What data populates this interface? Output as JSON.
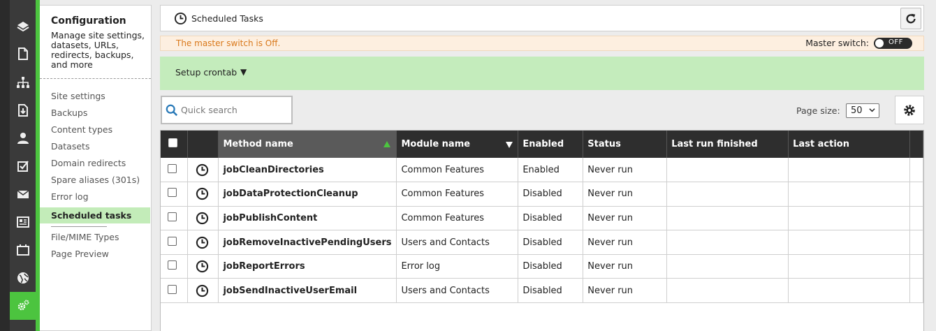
{
  "rail": {
    "icons": [
      "layers-icon",
      "document-icon",
      "sitemap-icon",
      "download-doc-icon",
      "user-icon",
      "checkbox-icon",
      "envelope-icon",
      "newspaper-icon",
      "calendar-icon",
      "globe-icon",
      "settings-icon"
    ],
    "active": "settings-icon",
    "accent": "#4cc43f"
  },
  "config": {
    "title": "Configuration",
    "description": "Manage site settings, datasets, URLs, redirects, backups, and more",
    "menu": [
      "Site settings",
      "Backups",
      "Content types",
      "Datasets",
      "Domain redirects",
      "Spare aliases (301s)",
      "Error log",
      "Scheduled tasks",
      "File/MIME Types",
      "Page Preview"
    ],
    "active": "Scheduled tasks"
  },
  "header": {
    "title": "Scheduled Tasks",
    "refresh_icon": "refresh-icon"
  },
  "warning": {
    "text": "The master switch is Off.",
    "master_label": "Master switch:",
    "toggle_state": "OFF",
    "color": "#d9781a"
  },
  "crontab": {
    "label": "Setup crontab",
    "arrow": "▼"
  },
  "search": {
    "placeholder": "Quick search"
  },
  "paging": {
    "label": "Page size:",
    "value": "50"
  },
  "table": {
    "columns": [
      "Method name",
      "Module name",
      "Enabled",
      "Status",
      "Last run finished",
      "Last action"
    ],
    "sorted_column": "Method name",
    "rows": [
      {
        "method": "jobCleanDirectories",
        "module": "Common Features",
        "enabled": "Enabled",
        "status": "Never run",
        "last_run": "",
        "last_action": ""
      },
      {
        "method": "jobDataProtectionCleanup",
        "module": "Common Features",
        "enabled": "Disabled",
        "status": "Never run",
        "last_run": "",
        "last_action": ""
      },
      {
        "method": "jobPublishContent",
        "module": "Common Features",
        "enabled": "Disabled",
        "status": "Never run",
        "last_run": "",
        "last_action": ""
      },
      {
        "method": "jobRemoveInactivePendingUsers",
        "module": "Users and Contacts",
        "enabled": "Disabled",
        "status": "Never run",
        "last_run": "",
        "last_action": ""
      },
      {
        "method": "jobReportErrors",
        "module": "Error log",
        "enabled": "Disabled",
        "status": "Never run",
        "last_run": "",
        "last_action": ""
      },
      {
        "method": "jobSendInactiveUserEmail",
        "module": "Users and Contacts",
        "enabled": "Disabled",
        "status": "Never run",
        "last_run": "",
        "last_action": ""
      }
    ]
  }
}
